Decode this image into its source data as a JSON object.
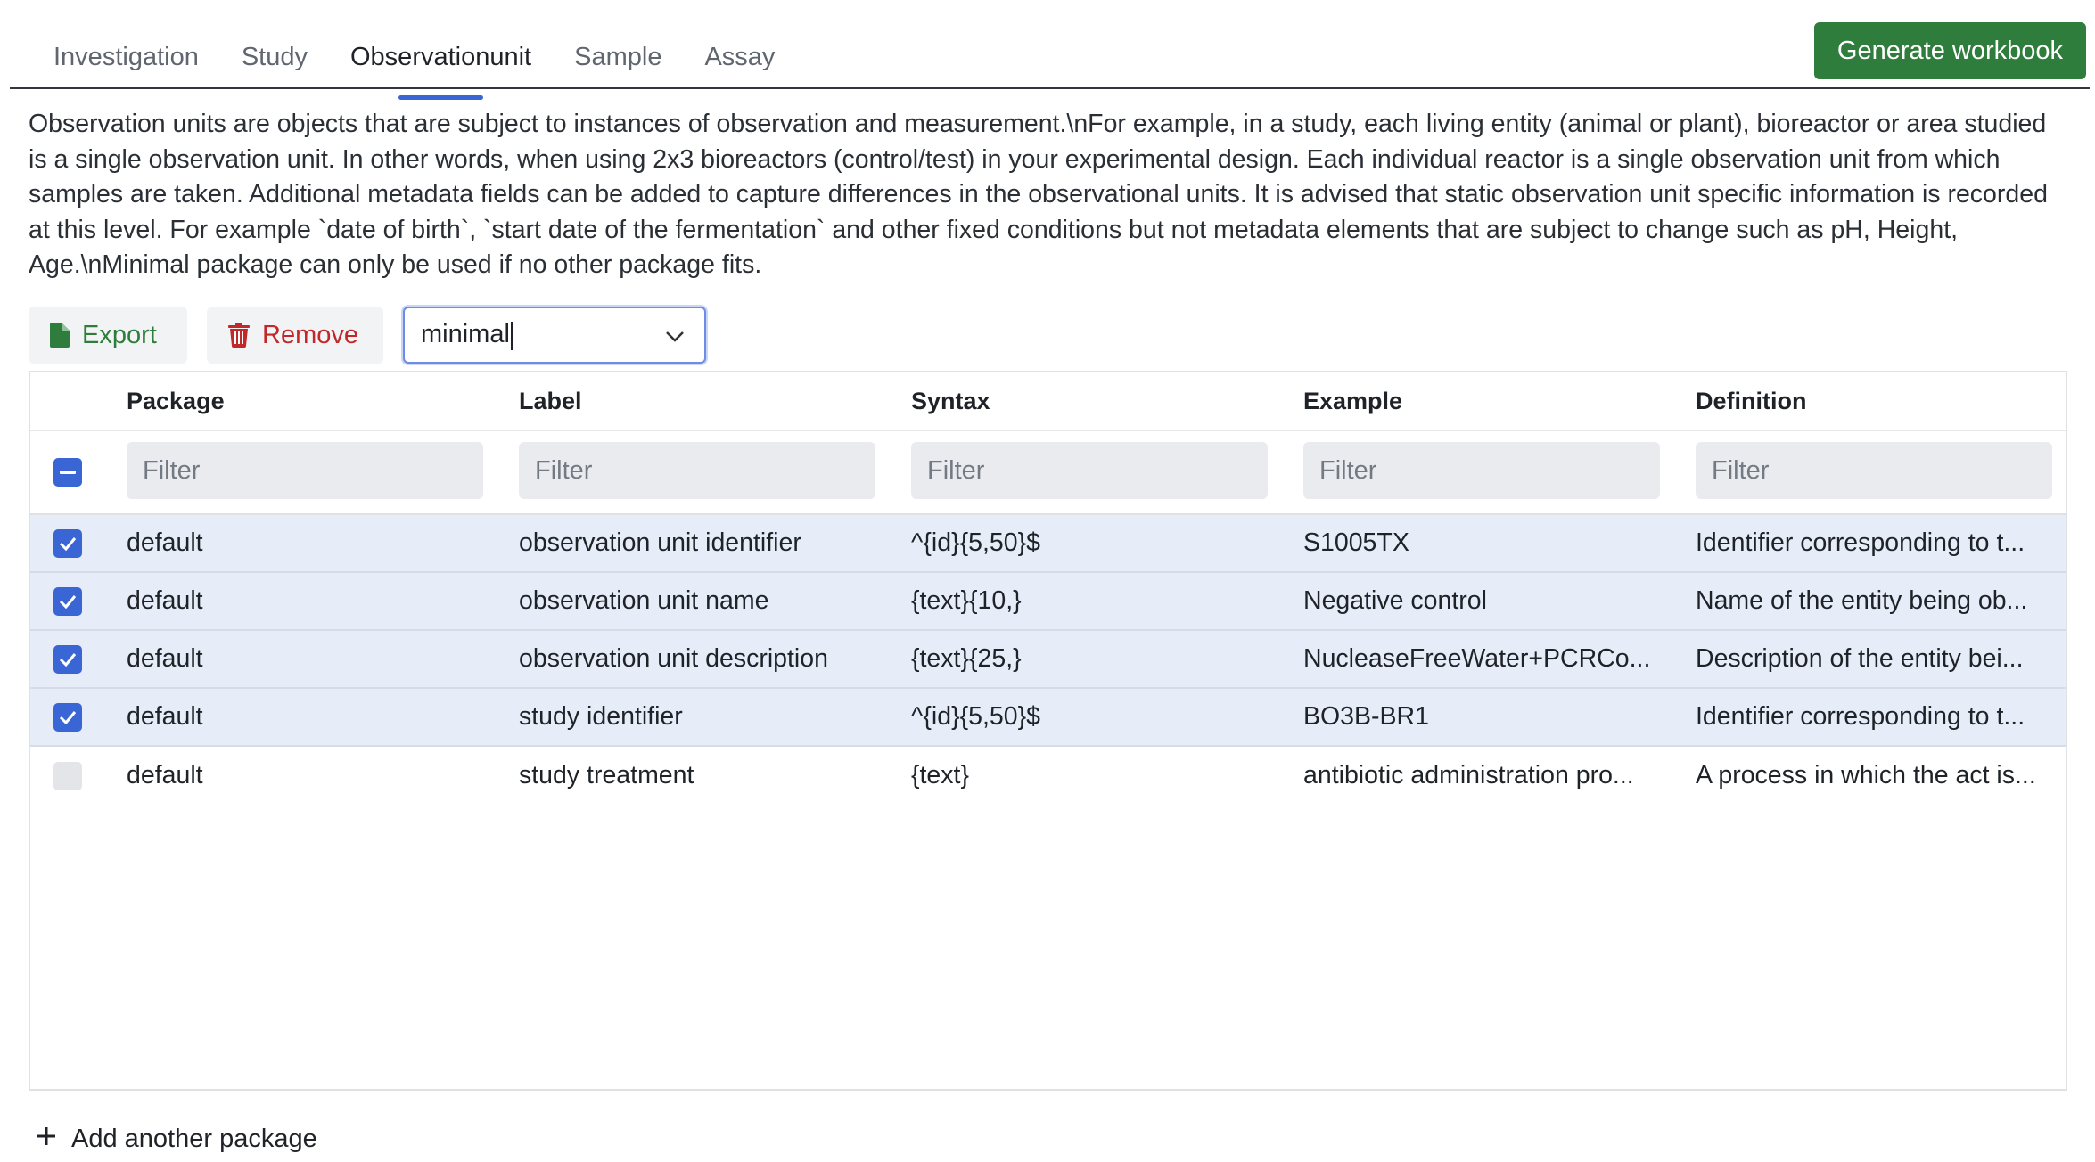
{
  "tabs": [
    {
      "label": "Investigation"
    },
    {
      "label": "Study"
    },
    {
      "label": "Observationunit"
    },
    {
      "label": "Sample"
    },
    {
      "label": "Assay"
    }
  ],
  "active_tab": "Observationunit",
  "generate_label": "Generate workbook",
  "description": "Observation units are objects that are subject to instances of observation and measurement.\\nFor example, in a study, each living entity (animal or plant), bioreactor or area studied is a single observation unit. In other words, when using 2x3 bioreactors (control/test) in your experimental design. Each individual reactor is a single observation unit from which samples are taken. Additional metadata fields can be added to capture differences in the observational units. It is advised that static observation unit specific information is recorded at this level. For example `date of birth`, `start date of the fermentation` and other fixed conditions but not metadata elements that are subject to change such as pH, Height, Age.\\nMinimal package can only be used if no other package fits.",
  "toolbar": {
    "export_label": "Export",
    "remove_label": "Remove",
    "package_select_value": "minimal"
  },
  "table": {
    "headers": [
      "Package",
      "Label",
      "Syntax",
      "Example",
      "Definition"
    ],
    "filter_placeholder": "Filter",
    "rows": [
      {
        "checked": true,
        "package": "default",
        "label": "observation unit identifier",
        "syntax": "^{id}{5,50}$",
        "example": "S1005TX",
        "definition": "Identifier corresponding to t..."
      },
      {
        "checked": true,
        "package": "default",
        "label": "observation unit name",
        "syntax": "{text}{10,}",
        "example": "Negative control",
        "definition": "Name of the entity being ob..."
      },
      {
        "checked": true,
        "package": "default",
        "label": "observation unit description",
        "syntax": "{text}{25,}",
        "example": "NucleaseFreeWater+PCRCo...",
        "definition": "Description of the entity bei..."
      },
      {
        "checked": true,
        "package": "default",
        "label": "study identifier",
        "syntax": "^{id}{5,50}$",
        "example": "BO3B-BR1",
        "definition": "Identifier corresponding to t..."
      },
      {
        "checked": false,
        "package": "default",
        "label": "study treatment",
        "syntax": "{text}",
        "example": "antibiotic administration pro...",
        "definition": "A process in which the act is..."
      }
    ]
  },
  "add_package_label": "Add another package",
  "colors": {
    "accent": "#3a66d5",
    "primary_button": "#2f7d3c",
    "danger": "#c0282b"
  }
}
